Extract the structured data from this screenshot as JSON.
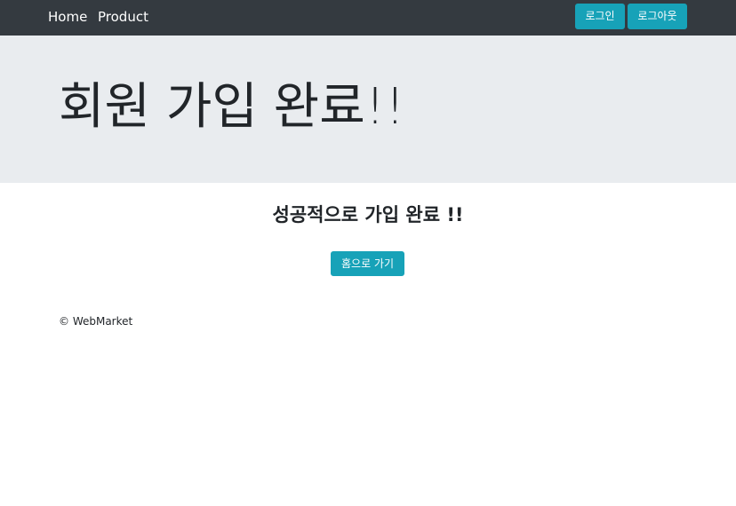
{
  "navbar": {
    "home_label": "Home",
    "product_label": "Product",
    "login_label": "로그인",
    "logout_label": "로그아웃"
  },
  "jumbotron": {
    "title": "회원 가입 완료!!"
  },
  "main": {
    "message": "성공적으로 가입 완료 !!",
    "home_button_label": "홈으로 가기"
  },
  "footer": {
    "text": "© WebMarket"
  },
  "colors": {
    "navbar_bg": "#343a40",
    "jumbotron_bg": "#e9ecef",
    "button_accent": "#17a2b8"
  }
}
